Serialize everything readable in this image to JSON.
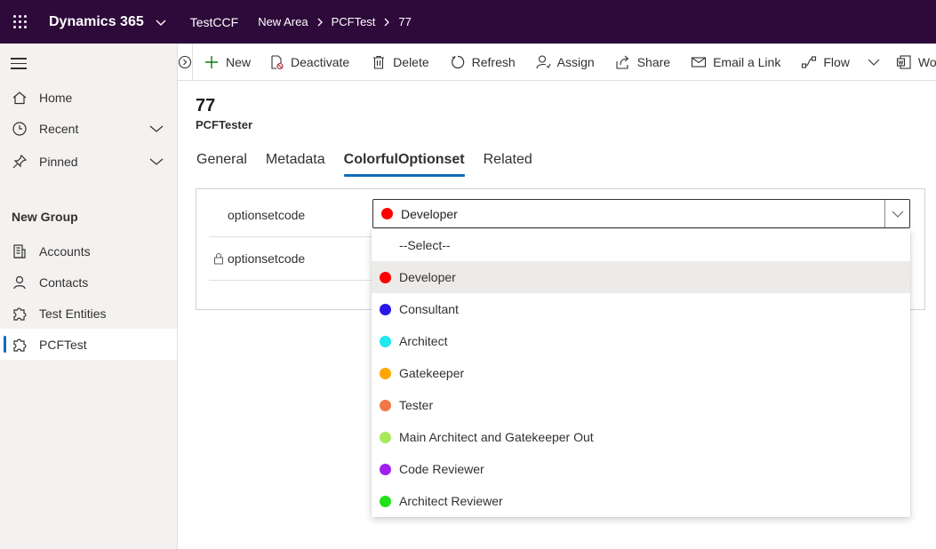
{
  "topbar": {
    "app_title": "Dynamics 365",
    "app_name": "TestCCF",
    "breadcrumbs": [
      "New Area",
      "PCFTest",
      "77"
    ]
  },
  "sidebar": {
    "items": [
      {
        "label": "Home",
        "icon": "home-icon"
      },
      {
        "label": "Recent",
        "icon": "clock-icon",
        "expandable": true
      },
      {
        "label": "Pinned",
        "icon": "pin-icon",
        "expandable": true
      }
    ],
    "group_title": "New Group",
    "group_items": [
      {
        "label": "Accounts",
        "icon": "accounts-icon"
      },
      {
        "label": "Contacts",
        "icon": "person-icon"
      },
      {
        "label": "Test Entities",
        "icon": "puzzle-icon"
      },
      {
        "label": "PCFTest",
        "icon": "puzzle-icon",
        "active": true
      }
    ]
  },
  "commandbar": {
    "new": "New",
    "deactivate": "Deactivate",
    "delete": "Delete",
    "refresh": "Refresh",
    "assign": "Assign",
    "share": "Share",
    "email_link": "Email a Link",
    "flow": "Flow",
    "word": "Wo"
  },
  "record": {
    "title": "77",
    "entity": "PCFTester"
  },
  "tabs": [
    {
      "label": "General"
    },
    {
      "label": "Metadata"
    },
    {
      "label": "ColorfulOptionset",
      "active": true
    },
    {
      "label": "Related"
    }
  ],
  "form": {
    "field1_label": "optionsetcode",
    "field2_label": "optionsetcode",
    "selected_value": "Developer",
    "selected_color": "#ff0000"
  },
  "dropdown": {
    "placeholder": "--Select--",
    "options": [
      {
        "label": "Developer",
        "color": "#ff0000",
        "selected": true
      },
      {
        "label": "Consultant",
        "color": "#2b16e8"
      },
      {
        "label": "Architect",
        "color": "#1ee8f0"
      },
      {
        "label": "Gatekeeper",
        "color": "#ffa500"
      },
      {
        "label": "Tester",
        "color": "#f07848"
      },
      {
        "label": "Main Architect and Gatekeeper Out",
        "color": "#a8e85a"
      },
      {
        "label": "Code Reviewer",
        "color": "#a020f0"
      },
      {
        "label": "Architect Reviewer",
        "color": "#22e01a"
      }
    ]
  }
}
